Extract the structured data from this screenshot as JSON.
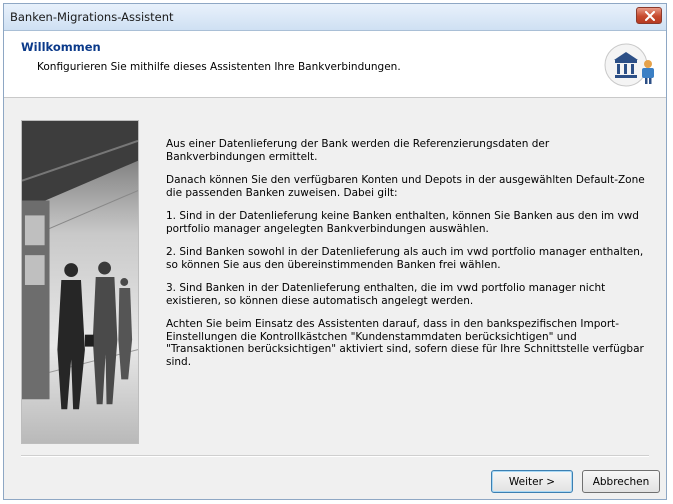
{
  "window": {
    "title": "Banken-Migrations-Assistent"
  },
  "header": {
    "title": "Willkommen",
    "subtitle": "Konfigurieren Sie mithilfe dieses Assistenten Ihre Bankverbindungen."
  },
  "content": {
    "paragraphs": [
      "Aus einer Datenlieferung der Bank werden die Referenzierungsdaten der Bankverbindungen ermittelt.",
      "Danach können Sie den verfügbaren Konten und Depots in der ausgewählten Default-Zone die passenden Banken zuweisen. Dabei gilt:",
      "1. Sind in der Datenlieferung keine Banken enthalten, können Sie Banken aus den im vwd portfolio manager angelegten Bankverbindungen auswählen.",
      "2. Sind Banken sowohl in der Datenlieferung als auch im vwd portfolio manager enthalten, so können Sie aus den übereinstimmenden Banken frei wählen.",
      "3. Sind Banken in der Datenlieferung enthalten, die im vwd portfolio manager nicht existieren, so können diese automatisch angelegt werden.",
      "Achten Sie beim Einsatz des Assistenten darauf, dass in den bankspezifischen Import-Einstellungen die Kontrollkästchen \"Kundenstammdaten berücksichtigen\" und \"Transaktionen berücksichtigen\" aktiviert sind, sofern diese für Ihre Schnittstelle verfügbar sind."
    ]
  },
  "buttons": {
    "next": "Weiter >",
    "cancel": "Abbrechen"
  },
  "icons": {
    "close": "close-icon",
    "logo": "bank-person-icon",
    "photo": "business-people-photo"
  },
  "colors": {
    "header_title": "#0b3a8a",
    "close": "#c74a2e"
  }
}
